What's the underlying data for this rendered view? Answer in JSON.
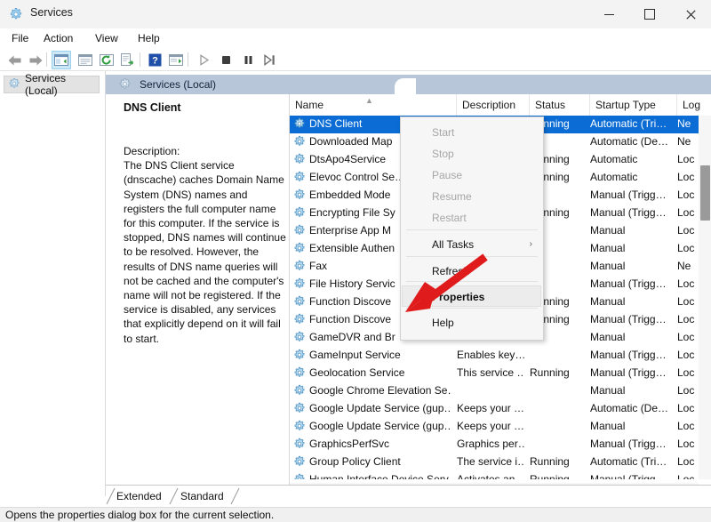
{
  "window": {
    "title": "Services",
    "icon": "services-gear-icon",
    "controls": {
      "minimize": "–",
      "maximize": "□",
      "close": "✕"
    }
  },
  "menubar": {
    "items": [
      "File",
      "Action",
      "View",
      "Help"
    ]
  },
  "toolbar": {
    "buttons": [
      "back-arrow-icon",
      "forward-arrow-icon",
      "show-hide-console-tree-icon",
      "properties-icon",
      "refresh-icon",
      "export-list-icon",
      "help-icon",
      "show-hide-action-pane-icon",
      "start-service-icon",
      "stop-service-icon",
      "pause-service-icon",
      "restart-service-icon"
    ]
  },
  "sidebar": {
    "items": [
      {
        "label": "Services (Local)",
        "icon": "services-gear-icon"
      }
    ]
  },
  "pane": {
    "header": {
      "label": "Services (Local)",
      "icon": "services-gear-icon"
    },
    "detail": {
      "service_name": "DNS Client",
      "description_label": "Description:",
      "description": "The DNS Client service (dnscache) caches Domain Name System (DNS) names and registers the full computer name for this computer. If the service is stopped, DNS names will continue to be resolved. However, the results of DNS name queries will not be cached and the computer's name will not be registered. If the service is disabled, any services that explicitly depend on it will fail to start."
    },
    "columns": [
      {
        "label": "Name",
        "sorted": "asc"
      },
      {
        "label": "Description"
      },
      {
        "label": "Status"
      },
      {
        "label": "Startup Type"
      },
      {
        "label": "Log"
      }
    ],
    "rows": [
      {
        "name": "DNS Client",
        "description": "",
        "status": "Running",
        "startup": "Automatic (Tri…",
        "logon": "Ne",
        "selected": true
      },
      {
        "name": "Downloaded Map",
        "description": "",
        "status": "",
        "startup": "Automatic (De…",
        "logon": "Ne"
      },
      {
        "name": "DtsApo4Service",
        "description": "",
        "status": "Running",
        "startup": "Automatic",
        "logon": "Loc"
      },
      {
        "name": "Elevoc Control Se…",
        "description": "",
        "status": "Running",
        "startup": "Automatic",
        "logon": "Loc"
      },
      {
        "name": "Embedded Mode",
        "description": "",
        "status": "",
        "startup": "Manual (Trigg…",
        "logon": "Loc"
      },
      {
        "name": "Encrypting File Sy",
        "description": "",
        "status": "Running",
        "startup": "Manual (Trigg…",
        "logon": "Loc"
      },
      {
        "name": "Enterprise App M",
        "description": "",
        "status": "",
        "startup": "Manual",
        "logon": "Loc"
      },
      {
        "name": "Extensible Authen",
        "description": "",
        "status": "",
        "startup": "Manual",
        "logon": "Loc"
      },
      {
        "name": "Fax",
        "description": "",
        "status": "",
        "startup": "Manual",
        "logon": "Ne"
      },
      {
        "name": "File History Servic",
        "description": "",
        "status": "",
        "startup": "Manual (Trigg…",
        "logon": "Loc"
      },
      {
        "name": "Function Discove",
        "description": "",
        "status": "Running",
        "startup": "Manual",
        "logon": "Loc"
      },
      {
        "name": "Function Discove",
        "description": "",
        "status": "Running",
        "startup": "Manual (Trigg…",
        "logon": "Loc"
      },
      {
        "name": "GameDVR and Br",
        "description": "",
        "status": "",
        "startup": "Manual",
        "logon": "Loc"
      },
      {
        "name": "GameInput Service",
        "description": "Enables key…",
        "status": "",
        "startup": "Manual (Trigg…",
        "logon": "Loc"
      },
      {
        "name": "Geolocation Service",
        "description": "This service …",
        "status": "Running",
        "startup": "Manual (Trigg…",
        "logon": "Loc"
      },
      {
        "name": "Google Chrome Elevation Se…",
        "description": "",
        "status": "",
        "startup": "Manual",
        "logon": "Loc"
      },
      {
        "name": "Google Update Service (gup…",
        "description": "Keeps your …",
        "status": "",
        "startup": "Automatic (De…",
        "logon": "Loc"
      },
      {
        "name": "Google Update Service (gup…",
        "description": "Keeps your …",
        "status": "",
        "startup": "Manual",
        "logon": "Loc"
      },
      {
        "name": "GraphicsPerfSvc",
        "description": "Graphics per…",
        "status": "",
        "startup": "Manual (Trigg…",
        "logon": "Loc"
      },
      {
        "name": "Group Policy Client",
        "description": "The service i…",
        "status": "Running",
        "startup": "Automatic (Tri…",
        "logon": "Loc"
      },
      {
        "name": "Human Interface Device Serv…",
        "description": "Activates an…",
        "status": "Running",
        "startup": "Manual (Trigg…",
        "logon": "Loc"
      }
    ],
    "tabs": [
      {
        "label": "Extended",
        "active": false
      },
      {
        "label": "Standard",
        "active": true
      }
    ]
  },
  "context_menu": {
    "items": [
      {
        "label": "Start",
        "disabled": true
      },
      {
        "label": "Stop",
        "disabled": true
      },
      {
        "label": "Pause",
        "disabled": true
      },
      {
        "label": "Resume",
        "disabled": true
      },
      {
        "label": "Restart",
        "disabled": true
      },
      {
        "label": "All Tasks",
        "submenu": true,
        "arrow": "›"
      },
      {
        "label": "Refresh"
      },
      {
        "label": "Properties",
        "highlighted": true
      },
      {
        "label": "Help"
      }
    ]
  },
  "annotation": {
    "type": "red-arrow",
    "points_to": "Properties",
    "color": "#e01b1b"
  },
  "statusbar": {
    "text": "Opens the properties dialog box for the current selection."
  },
  "colors": {
    "selection_blue": "#0a6cd4",
    "pane_header": "#b8c6d9",
    "toolbar_selected": "#cce8f6",
    "annotation_red": "#e01b1b"
  }
}
